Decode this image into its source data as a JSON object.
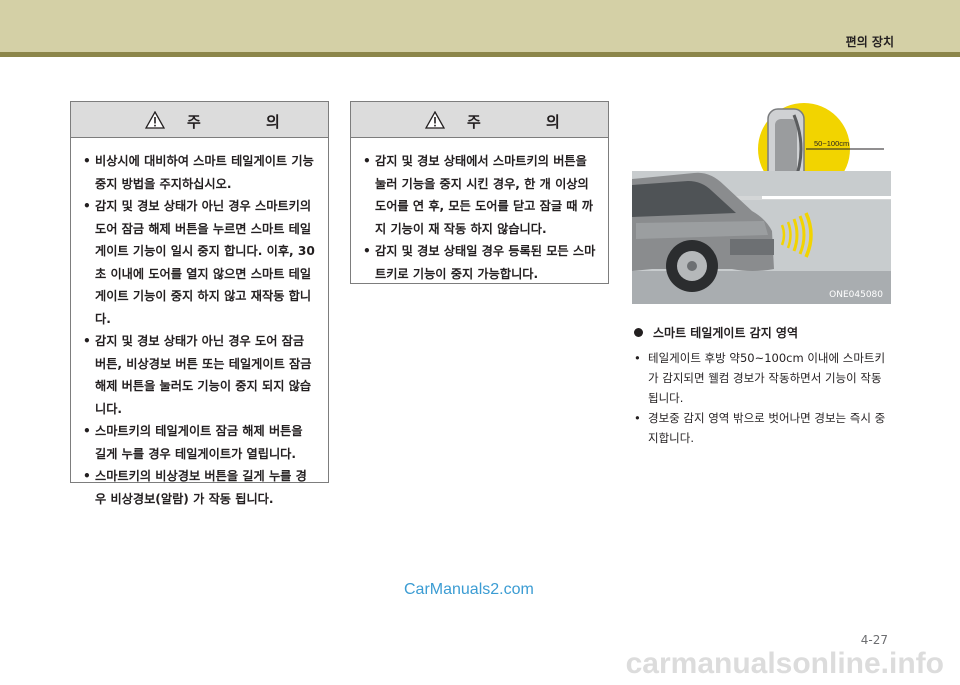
{
  "header": {
    "section_title": "편의 장치"
  },
  "caution_left": {
    "label": "주 의",
    "items": [
      "비상시에 대비하여 스마트 테일게이트 기능 중지 방법을 주지하십시오.",
      "감지 및 경보 상태가 아닌 경우 스마트키의 도어 잠금 해제 버튼을 누르면 스마트 테일게이트 기능이 일시 중지 합니다. 이후, 30초 이내에 도어를 열지 않으면 스마트 테일게이트 기능이 중지 하지 않고 재작동 합니다.",
      "감지 및 경보 상태가 아닌 경우 도어 잠금 버튼, 비상경보 버튼 또는 테일게이트 잠금 해제 버튼을 눌러도 기능이 중지 되지 않습니다.",
      "스마트키의 테일게이트 잠금 해제 버튼을 길게 누를 경우 테일게이트가 열립니다.",
      "스마트키의 비상경보 버튼을 길게 누를 경우 비상경보(알람) 가 작동 됩니다."
    ]
  },
  "caution_right": {
    "label": "주 의",
    "items": [
      "감지 및 경보 상태에서 스마트키의 버튼을 눌러 기능을 중지 시킨 경우, 한 개 이상의 도어를 연 후, 모든 도어를 닫고 잠글 때 까지 기능이 재 작동 하지 않습니다.",
      "감지 및 경보 상태일 경우 등록된 모든 스마트키로 기능이 중지 가능합니다."
    ]
  },
  "figure": {
    "range_label": "50~100cm",
    "code": "ONE045080"
  },
  "zone": {
    "heading": "스마트 테일게이트 감지 영역",
    "items": [
      "테일게이트 후방 약50~100cm 이내에 스마트키가 감지되면 웰컴 경보가 작동하면서 기능이 작동됩니다.",
      "경보중 감지 영역 밖으로 벗어나면 경보는 즉시 중지합니다."
    ]
  },
  "footer": {
    "watermark": "CarManuals2.com",
    "page_number": "4-27",
    "bottom_watermark": "carmanualsonline.info"
  },
  "colors": {
    "header_band": "#d4d0a6",
    "header_line": "#8c864a",
    "zone_yellow": "#f2d400",
    "car_body": "#8a8c8e"
  }
}
